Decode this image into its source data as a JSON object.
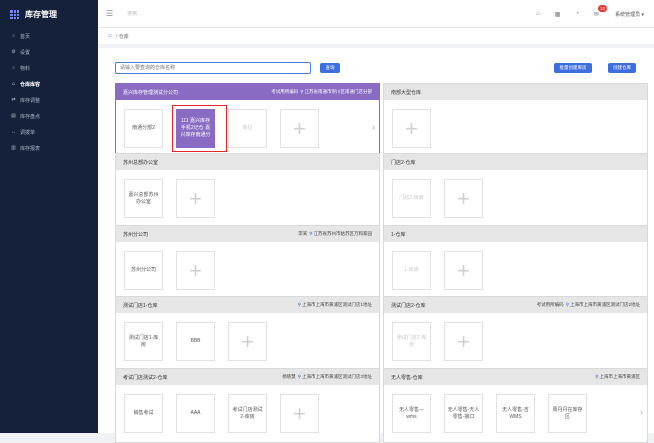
{
  "app": {
    "title": "库存管理"
  },
  "sidebar": {
    "items": [
      {
        "label": "首页",
        "icon": "circle-icon"
      },
      {
        "label": "设置",
        "icon": "gear-icon"
      },
      {
        "label": "物料",
        "icon": "circle-icon"
      },
      {
        "label": "仓库库容",
        "icon": "warehouse-icon",
        "active": true
      },
      {
        "label": "库存调整",
        "icon": "adjust-icon"
      },
      {
        "label": "库存盘点",
        "icon": "doc-icon"
      },
      {
        "label": "调拨单",
        "icon": "transfer-icon"
      },
      {
        "label": "库存报表",
        "icon": "chart-icon"
      }
    ]
  },
  "topbar": {
    "search_hint": "搜索...",
    "notification_count": "10",
    "user": "系统管理员"
  },
  "breadcrumb": {
    "current": "仓库"
  },
  "toolbar": {
    "search_placeholder": "请输入要查询的仓库名称",
    "search_label": "查询",
    "batch_create": "批量创建库房",
    "create": "创建仓库"
  },
  "warehouses": [
    {
      "name": "嘉兴库存管理测试分公司",
      "info": "考试用所编码",
      "address": "江苏省南通市崇川区南通门店分部",
      "active": true,
      "cells": [
        {
          "label": "南通分部2"
        },
        {
          "label": "111 嘉兴库存手机2记仓 嘉兴库存南通分",
          "selected": true
        },
        {
          "label": "库位",
          "faint": true
        }
      ],
      "more": true
    },
    {
      "name": "南部大型仓库",
      "info": "",
      "address": "",
      "cells": []
    },
    {
      "name": "苏州总部办公室",
      "info": "",
      "address": "",
      "cells": [
        {
          "label": "嘉兴总部苏州办公室"
        }
      ]
    },
    {
      "name": "门店2-仓库",
      "info": "",
      "address": "",
      "cells": [
        {
          "label": "门店2-库房",
          "faint": true
        }
      ]
    },
    {
      "name": "苏州分公司",
      "info": "李某",
      "address": "江苏省苏州市姑苏区万和家园",
      "cells": [
        {
          "label": "苏州分公司"
        }
      ]
    },
    {
      "name": "1-仓库",
      "info": "",
      "address": "",
      "cells": [
        {
          "label": "1-库房",
          "faint": true
        }
      ]
    },
    {
      "name": "测试门店1-仓库",
      "info": "",
      "address": "上海市上海市黄浦区测试门店1地址",
      "cells": [
        {
          "label": "测试门店1-库房"
        },
        {
          "label": "BBB"
        }
      ]
    },
    {
      "name": "测试门店2-仓库",
      "info": "考试用所编码",
      "address": "上海市上海市黄浦区测试门店2地址",
      "cells": [
        {
          "label": "测试门店2-库房",
          "faint": true
        }
      ]
    },
    {
      "name": "考试门店测试2-仓库",
      "info": "杨晓慧",
      "address": "上海市上海市黄浦区测试门店2地址",
      "cells": [
        {
          "label": "销售考试"
        },
        {
          "label": "AAA"
        },
        {
          "label": "考试门店测试2-库房"
        }
      ]
    },
    {
      "name": "无人零售-仓库",
      "info": "",
      "address": "上海市上海市黄浦区",
      "cells": [
        {
          "label": "无人零售---wms"
        },
        {
          "label": "无人零售-无人零售-接口"
        },
        {
          "label": "无人零售-吉WMS"
        },
        {
          "label": "周丹丹在库存区"
        }
      ],
      "more": true,
      "noadd": true
    }
  ],
  "colors": {
    "sidebar": "#15213a",
    "accent": "#3d6ee0",
    "selected_cell": "#8a6bc4",
    "highlight": "#e3272b"
  }
}
